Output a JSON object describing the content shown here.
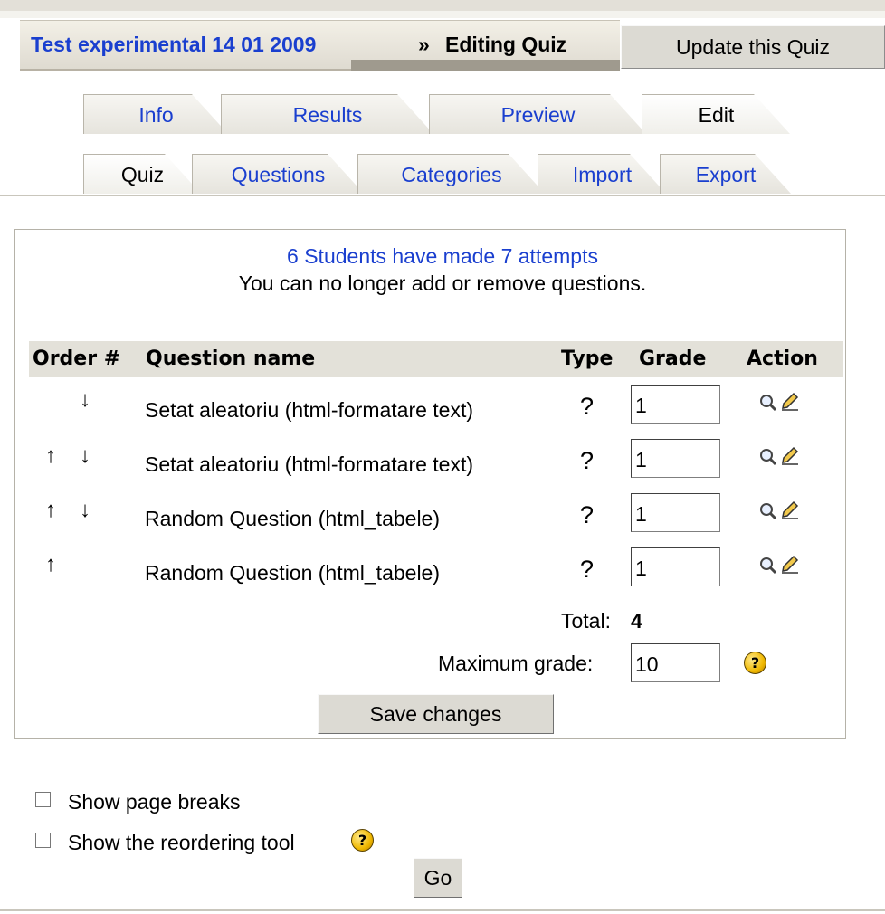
{
  "navbar": {
    "course_link": "Test experimental 14 01 2009",
    "separator": "»",
    "current": "Editing Quiz",
    "update_button": "Update this Quiz"
  },
  "tabs_row1": [
    {
      "label": "Info",
      "selected": false
    },
    {
      "label": "Results",
      "selected": false
    },
    {
      "label": "Preview",
      "selected": false
    },
    {
      "label": "Edit",
      "selected": true
    }
  ],
  "tabs_row2": [
    {
      "label": "Quiz",
      "selected": true
    },
    {
      "label": "Questions",
      "selected": false
    },
    {
      "label": "Categories",
      "selected": false
    },
    {
      "label": "Import",
      "selected": false
    },
    {
      "label": "Export",
      "selected": false
    }
  ],
  "notice": {
    "attempts": "6 Students have made 7 attempts",
    "locked": "You can no longer add or remove questions."
  },
  "table": {
    "headers": {
      "order": "Order #",
      "name": "Question name",
      "type": "Type",
      "grade": "Grade",
      "action": "Action"
    },
    "rows": [
      {
        "name": "Setat aleatoriu (html-formatare text)",
        "type": "?",
        "grade": "1",
        "up": false,
        "down": true
      },
      {
        "name": "Setat aleatoriu (html-formatare text)",
        "type": "?",
        "grade": "1",
        "up": true,
        "down": true
      },
      {
        "name": "Random Question (html_tabele)",
        "type": "?",
        "grade": "1",
        "up": true,
        "down": true
      },
      {
        "name": "Random Question (html_tabele)",
        "type": "?",
        "grade": "1",
        "up": true,
        "down": false
      }
    ],
    "icons": {
      "up": "↑",
      "down": "↓",
      "preview": "magnifier-icon",
      "edit": "edit-pencil-icon"
    },
    "total_label": "Total:",
    "total_value": "4",
    "max_grade_label": "Maximum grade:",
    "max_grade_value": "10",
    "help_icon_glyph": "?",
    "save_button": "Save changes"
  },
  "options": {
    "show_page_breaks": "Show page breaks",
    "show_reorder_tool": "Show the reordering tool",
    "go_button": "Go"
  },
  "colors": {
    "link": "#1a3fcf",
    "tab_bg": "#e6e4dd",
    "header_bg": "#e3e1d9"
  }
}
